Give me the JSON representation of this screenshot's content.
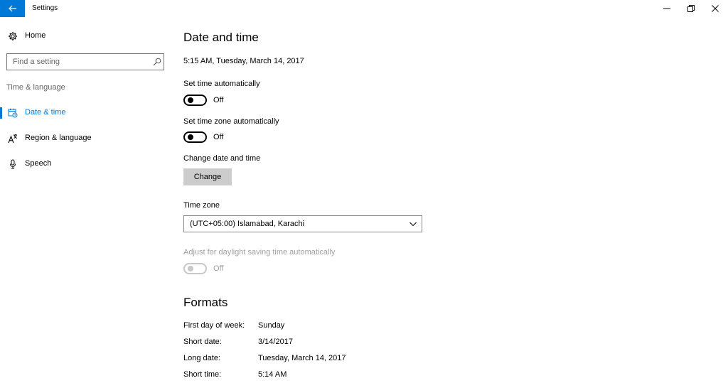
{
  "window": {
    "title": "Settings",
    "minimize_glyph": "—",
    "maximize_glyph": "❐",
    "close_glyph": "✕"
  },
  "sidebar": {
    "home_label": "Home",
    "search_placeholder": "Find a setting",
    "section_label": "Time & language",
    "items": [
      {
        "label": "Date & time",
        "icon": "calendar-clock-icon",
        "selected": true
      },
      {
        "label": "Region & language",
        "icon": "region-language-icon",
        "selected": false
      },
      {
        "label": "Speech",
        "icon": "microphone-icon",
        "selected": false
      }
    ]
  },
  "main": {
    "title": "Date and time",
    "current_datetime": "5:15 AM, Tuesday, March 14, 2017",
    "set_time_auto": {
      "label": "Set time automatically",
      "state": "Off"
    },
    "set_timezone_auto": {
      "label": "Set time zone automatically",
      "state": "Off"
    },
    "change_section": {
      "label": "Change date and time",
      "button": "Change"
    },
    "timezone": {
      "label": "Time zone",
      "value": "(UTC+05:00) Islamabad, Karachi"
    },
    "dst": {
      "label": "Adjust for daylight saving time automatically",
      "state": "Off",
      "disabled": true
    },
    "formats": {
      "title": "Formats",
      "rows": [
        {
          "key": "First day of week:",
          "value": "Sunday"
        },
        {
          "key": "Short date:",
          "value": "3/14/2017"
        },
        {
          "key": "Long date:",
          "value": "Tuesday, March 14, 2017"
        },
        {
          "key": "Short time:",
          "value": "5:14 AM"
        }
      ]
    }
  },
  "colors": {
    "accent": "#0078d7",
    "disabled": "#a0a0a0",
    "button_bg": "#cccccc"
  }
}
